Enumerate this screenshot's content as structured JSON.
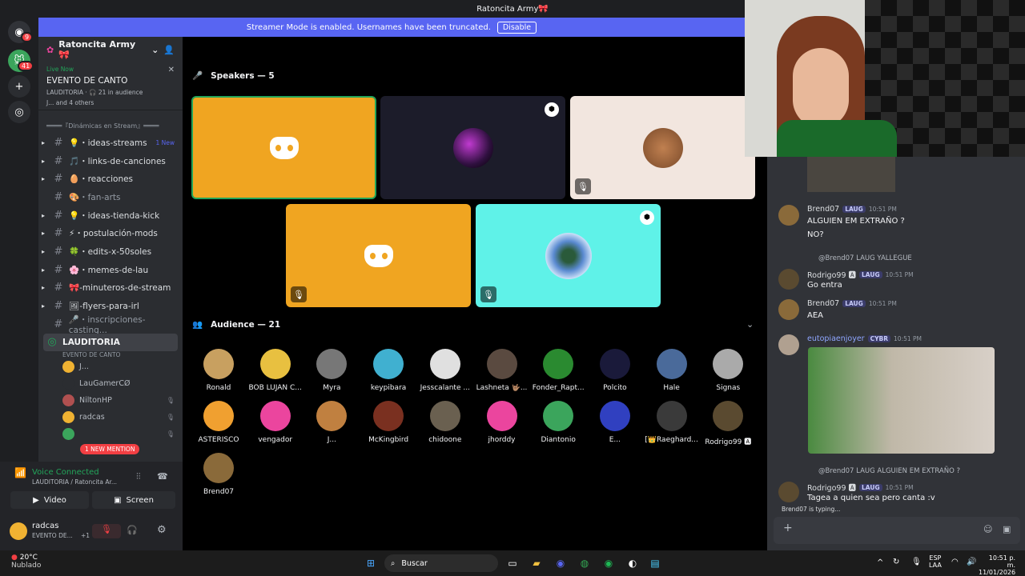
{
  "window_title": "Ratoncita Army🎀",
  "banner": {
    "text": "Streamer Mode is enabled. Usernames have been truncated.",
    "button": "Disable"
  },
  "server_rail": {
    "dm_badge": "9",
    "server_badge": "41"
  },
  "server": {
    "name": "Ratoncita Army 🎀",
    "live_label": "Live Now",
    "event_title": "EVENTO DE CANTO",
    "live_info": "LAUDITORIA · 🎧 21 in audience",
    "live_others": "J... and 4 others"
  },
  "category": "════『Dinámicas en Stream』════",
  "channels": [
    {
      "label": "💡・ideas-streams",
      "badge": "1 New",
      "arrow": "▸"
    },
    {
      "label": "🎵・links-de-canciones",
      "badge": "",
      "arrow": "▸"
    },
    {
      "label": "🥚・reacciones",
      "badge": "",
      "arrow": "▸"
    },
    {
      "label": "🎨・fan-arts",
      "badge": "",
      "arrow": ""
    },
    {
      "label": "💡・ideas-tienda-kick",
      "badge": "",
      "arrow": "▸"
    },
    {
      "label": "⚡・postulación-mods",
      "badge": "",
      "arrow": "▸"
    },
    {
      "label": "🍀・edits-x-50soles",
      "badge": "",
      "arrow": "▸"
    },
    {
      "label": "🌸・memes-de-lau",
      "badge": "",
      "arrow": "▸"
    },
    {
      "label": "🎀-minuteros-de-stream",
      "badge": "",
      "arrow": "▸"
    },
    {
      "label": "🖼-flyers-para-irl",
      "badge": "",
      "arrow": "▸"
    },
    {
      "label": "🎤・inscripciones-casting...",
      "badge": "",
      "arrow": ""
    }
  ],
  "stage_channel": {
    "label": "LAUDITORIA",
    "sub": "EVENTO DE CANTO"
  },
  "voice_users": [
    "J...",
    "LauGamerCØ",
    "NiltonHP",
    "radcas",
    ""
  ],
  "new_mention": "1 NEW MENTION",
  "voice": {
    "status": "Voice Connected",
    "channel": "LAUDITORIA / Ratoncita Ar...",
    "video": "Video",
    "screen": "Screen"
  },
  "me": {
    "name": "radcas",
    "status": "EVENTO DE...",
    "extra": "+1"
  },
  "speakers_title": "Speakers — 5",
  "audience_title": "Audience — 21",
  "audience": [
    {
      "name": "Ronald",
      "color": "#c8a060"
    },
    {
      "name": "BOB LUJAN C...",
      "color": "#e8c040"
    },
    {
      "name": "Myra",
      "color": "#777777"
    },
    {
      "name": "keypibara",
      "color": "#40b0d0"
    },
    {
      "name": "Jesscalante ...",
      "color": "#e0e0e0"
    },
    {
      "name": "Lashneta 🤟🏽...",
      "color": "#5a4a40"
    },
    {
      "name": "Fonder_Rapt...",
      "color": "#2a8a30"
    },
    {
      "name": "Polcito",
      "color": "#1a1a3a"
    },
    {
      "name": "Hale",
      "color": "#4a6a9a"
    },
    {
      "name": "Signas",
      "color": "#aaaaaa"
    },
    {
      "name": "ASTERISCO",
      "color": "#f0a030"
    },
    {
      "name": "vengador",
      "color": "#eb459e"
    },
    {
      "name": "J...",
      "color": "#c08040"
    },
    {
      "name": "McKingbird",
      "color": "#7a3020"
    },
    {
      "name": "chidoone",
      "color": "#6a6050"
    },
    {
      "name": "jhorddy",
      "color": "#eb459e"
    },
    {
      "name": "Diantonio",
      "color": "#3ba55c"
    },
    {
      "name": "E...",
      "color": "#3040c0"
    },
    {
      "name": "[👑Raeghard...",
      "color": "#3a3a3a"
    },
    {
      "name": "Rodrigo99 🅰",
      "color": "#5a4a30"
    },
    {
      "name": "Brend07",
      "color": "#8a6a3a"
    }
  ],
  "chat": [
    {
      "name": "Brend07",
      "tag": "LAUG",
      "time": "10:51 PM",
      "lines": [
        "ALGUIEN EM EXTRAÑO ?",
        "NO?"
      ]
    },
    {
      "reply": "@Brend07 LAUG YALLEGUE",
      "name": "Rodrigo99 🅰",
      "tag": "LAUG",
      "time": "10:51 PM",
      "lines": [
        "Go entra"
      ]
    },
    {
      "name": "Brend07",
      "tag": "LAUG",
      "time": "10:51 PM",
      "lines": [
        "AEA"
      ]
    },
    {
      "name": "eutopiaenjoyer",
      "tag": "CYBR",
      "time": "10:51 PM",
      "lines": []
    },
    {
      "reply": "@Brend07 LAUG ALGUIEN EM EXTRAÑO ?",
      "name": "Rodrigo99 🅰",
      "tag": "LAUG",
      "time": "10:51 PM",
      "lines": [
        "Tagea a quien sea pero canta :v"
      ]
    }
  ],
  "typing": "Brend07 is typing...",
  "taskbar": {
    "temp": "20°C",
    "weather": "Nublado",
    "search": "Buscar",
    "lang": "ESP",
    "lang2": "LAA",
    "time": "10:51 p. m.",
    "date": "11/01/2026"
  }
}
